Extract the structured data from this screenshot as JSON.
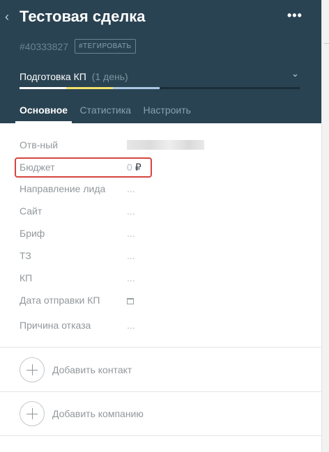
{
  "deal": {
    "title": "Тестовая сделка",
    "id": "#40333827",
    "tag_button": "#ТЕГИРОВАТЬ",
    "more_glyph": "•••",
    "back_glyph": "‹"
  },
  "stage": {
    "name": "Подготовка КП",
    "duration": "(1 день)",
    "progress_colors": [
      "#ffffff",
      "#f2e36b",
      "#aac8e4"
    ]
  },
  "tabs": [
    {
      "label": "Основное",
      "active": true
    },
    {
      "label": "Статистика",
      "active": false
    },
    {
      "label": "Настроить",
      "active": false
    }
  ],
  "fields": {
    "responsible": {
      "label": "Отв-ный"
    },
    "budget": {
      "label": "Бюджет",
      "value": "0",
      "currency": "₽"
    },
    "lead_direction": {
      "label": "Направление лида",
      "value": "..."
    },
    "site": {
      "label": "Сайт",
      "value": "..."
    },
    "brief": {
      "label": "Бриф",
      "value": "..."
    },
    "tz": {
      "label": "ТЗ",
      "value": "..."
    },
    "kp": {
      "label": "КП",
      "value": "..."
    },
    "kp_send_date": {
      "label": "Дата отправки КП",
      "icon": "calendar-icon"
    },
    "reject_reason": {
      "label": "Причина отказа",
      "value": "..."
    }
  },
  "actions": {
    "add_contact": "Добавить контакт",
    "add_company": "Добавить компанию"
  },
  "colors": {
    "header_bg": "#2a4352",
    "highlight_border": "#d6453d"
  }
}
